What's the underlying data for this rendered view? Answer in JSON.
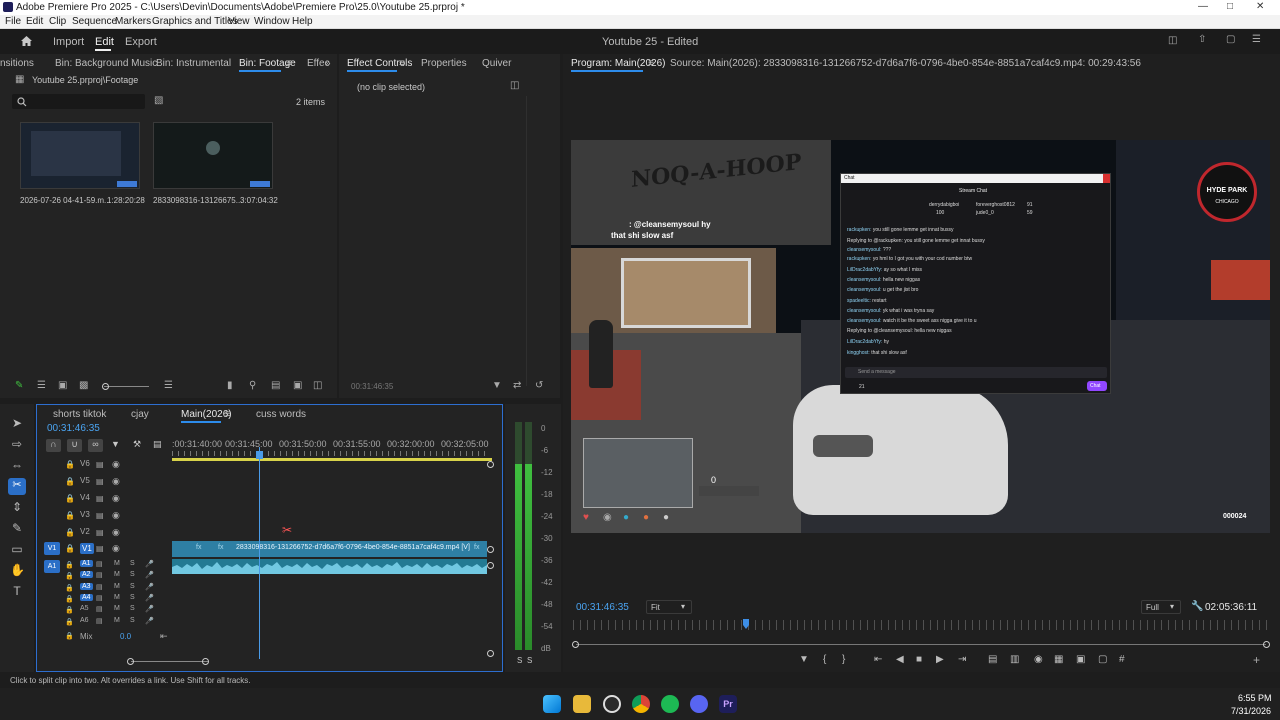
{
  "window": {
    "title": "Adobe Premiere Pro 2025 - C:\\Users\\Devin\\Documents\\Adobe\\Premiere Pro\\25.0\\Youtube 25.prproj *",
    "menu": [
      "File",
      "Edit",
      "Clip",
      "Sequence",
      "Markers",
      "Graphics and Titles",
      "View",
      "Window",
      "Help"
    ]
  },
  "header": {
    "nav": [
      "Import",
      "Edit",
      "Export"
    ],
    "active": "Edit",
    "project_title": "Youtube 25 - Edited"
  },
  "project_panel": {
    "tabs": [
      "nsitions",
      "Bin: Background Music",
      "Bin: Instrumental",
      "Bin: Footage",
      "Effec",
      "»"
    ],
    "active_tab": "Bin: Footage",
    "path": "Youtube 25.prproj\\Footage",
    "item_count": "2 items",
    "items": [
      {
        "name": "2026-07-26 04-41-59.m...",
        "duration": "1:28:20:28"
      },
      {
        "name": "2833098316-13126675...",
        "duration": "3:07:04:32"
      }
    ]
  },
  "effect_controls": {
    "tabs": [
      "Effect Controls",
      "Properties",
      "Quiver"
    ],
    "message": "(no clip selected)",
    "timecode": "00:31:46:35"
  },
  "program_monitor": {
    "tab": "Program: Main(2026)",
    "source": "Source: Main(2026): 2833098316-131266752-d7d6a7f6-0796-4be0-854e-8851a7caf4c9.mp4: 00:29:43:56",
    "timecode": "00:31:46:35",
    "fit": "Fit",
    "quality": "Full",
    "duration": "02:05:36:11"
  },
  "timeline": {
    "tabs": [
      "shorts tiktok",
      "cjay",
      "Main(2026)",
      "cuss words"
    ],
    "active_tab": "Main(2026)",
    "timecode": "00:31:46:35",
    "ruler": [
      ":00:31:40:00",
      "00:31:45:00",
      "00:31:50:00",
      "00:31:55:00",
      "00:32:00:00",
      "00:32:05:00"
    ],
    "video_tracks": [
      "V6",
      "V5",
      "V4",
      "V3",
      "V2",
      "V1"
    ],
    "audio_tracks": [
      "A1",
      "A2",
      "A3",
      "A4",
      "A5",
      "A6"
    ],
    "mix_label": "Mix",
    "mix_value": "0.0",
    "clip_name": "2833098316-131266752-d7d6a7f6-0796-4be0-854e-8851a7caf4c9.mp4 [V]",
    "fx_label": "fx",
    "src_v1": "V1",
    "src_a1": "A1"
  },
  "meter": {
    "labels": [
      "0",
      "-6",
      "-12",
      "-18",
      "-24",
      "-30",
      "-36",
      "-42",
      "-48",
      "-54",
      "dB"
    ],
    "solo": [
      "S",
      "S"
    ]
  },
  "video_frame": {
    "stream_chat_title": "Stream Chat",
    "chat_header": "Chat",
    "users": [
      "derrydabigboi",
      "foreverghost0812",
      "jude0_0"
    ],
    "counts": [
      "100",
      "91",
      "59"
    ],
    "messages": [
      {
        "user": "rackupken:",
        "text": "you still gone lemme get innat bussy"
      },
      {
        "user": "",
        "text": "Replying to @rackupken: you still gone lemme get innat bussy"
      },
      {
        "user": "cleansemysoul:",
        "text": "???"
      },
      {
        "user": "rackupken:",
        "text": "yo hml to I got you with your cod number btw"
      },
      {
        "user": "LilDrac2dabYfy:",
        "text": "ay so what I miss"
      },
      {
        "user": "cleansemysoul:",
        "text": "hella new niggas"
      },
      {
        "user": "cleansemysoul:",
        "text": "u get the jist bro"
      },
      {
        "user": "spadeeltic:",
        "text": "restart"
      },
      {
        "user": "cleansemysoul:",
        "text": "yk what i was tryna say"
      },
      {
        "user": "cleansemysoul:",
        "text": "watch it be the sweet ass nigga give it to u"
      },
      {
        "user": "",
        "text": "Replying to @cleansemysoul: hella new niggas"
      },
      {
        "user": "LilDrac2dabYfy:",
        "text": "hy"
      },
      {
        "user": "kingghost:",
        "text": "that shi slow asf"
      }
    ],
    "send_placeholder": "Send a message",
    "chat_button": "Chat",
    "points": "21",
    "overlay_msg_user": ": @cleansemysoul hy",
    "overlay_msg": "that shi slow asf",
    "logo_line1": "HYDE PARK",
    "logo_line2": "CHICAGO",
    "money": "000024",
    "building_text": "NOQ-A-HOOP",
    "hud_value": "0"
  },
  "status_bar": "Click to split clip into two. Alt overrides a link. Use Shift for all tracks.",
  "taskbar": {
    "time": "6:55 PM",
    "date": "7/31/2026"
  }
}
